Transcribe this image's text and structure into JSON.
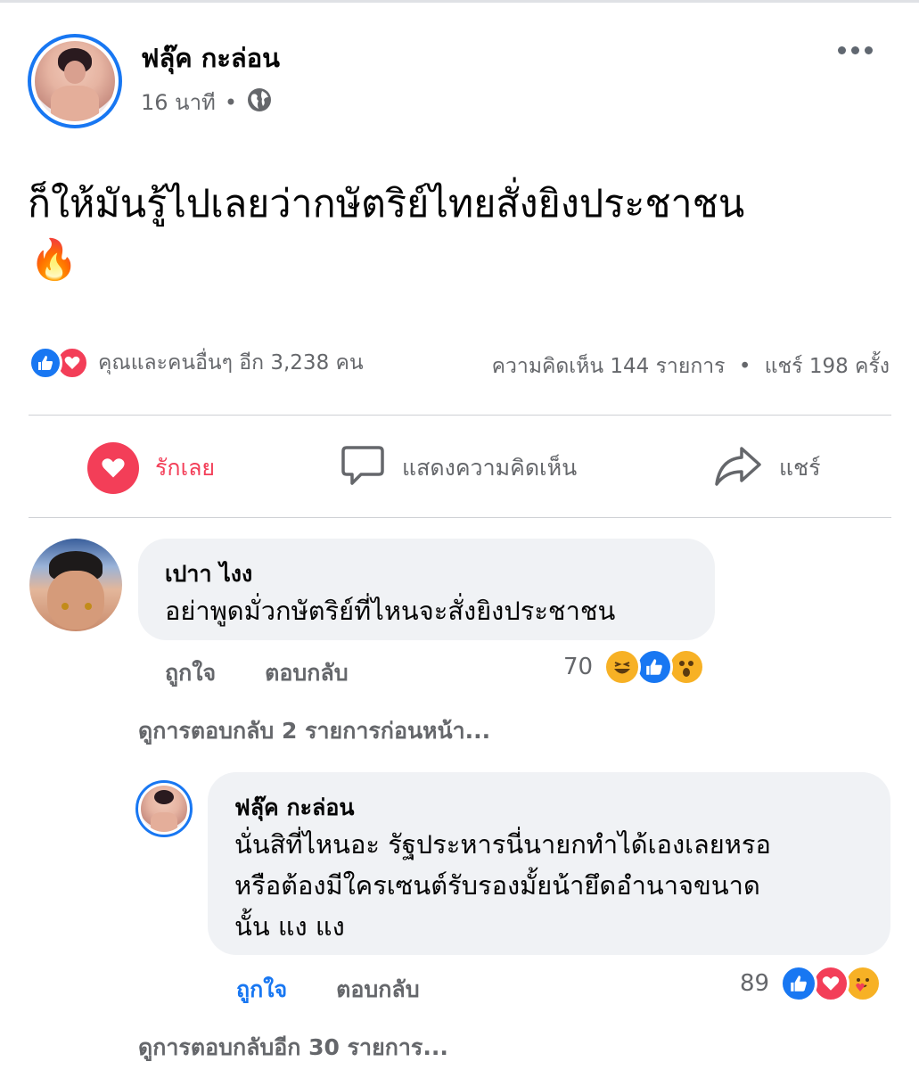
{
  "post": {
    "author": "ฟลุ๊ค กะล่อน",
    "time": "16 นาที",
    "separator": "•",
    "text": "ก็ให้มันรู้ไปเลยว่ากษัตริย์ไทยสั่งยิงประชาชน",
    "emoji": "🔥"
  },
  "stats": {
    "reactions_text": "คุณและคนอื่นๆ อีก 3,238 คน",
    "comments_text": "ความคิดเห็น 144 รายการ",
    "dot": "•",
    "shares_text": "แชร์ 198 ครั้ง"
  },
  "actions": {
    "love": "รักเลย",
    "comment": "แสดงความคิดเห็น",
    "share": "แชร์"
  },
  "comments": [
    {
      "name": "เปาา ไงง",
      "text": "อย่าพูดมั่วกษัตริย์ที่ไหนจะสั่งยิงประชาชน",
      "like": "ถูกใจ",
      "reply": "ตอบกลับ",
      "reaction_count": "70"
    }
  ],
  "view_previous": "ดูการตอบกลับ 2 รายการก่อนหน้า...",
  "reply": {
    "name": "ฟลุ๊ค กะล่อน",
    "line1": "นั่นสิที่ไหนอะ  รัฐประหารนี่นายกทำได้เองเลยหรอ",
    "line2": "หรือต้องมีใครเซนต์รับรองมั้ยน้ายึดอำนาจขนาด",
    "line3": "นั้น แง แง",
    "like": "ถูกใจ",
    "reply": "ตอบกลับ",
    "reaction_count": "89"
  },
  "view_more": "ดูการตอบกลับอีก 30 รายการ...",
  "colors": {
    "accent": "#1877f2",
    "love": "#f33e58",
    "bubble": "#f0f2f5",
    "muted": "#65676b"
  }
}
